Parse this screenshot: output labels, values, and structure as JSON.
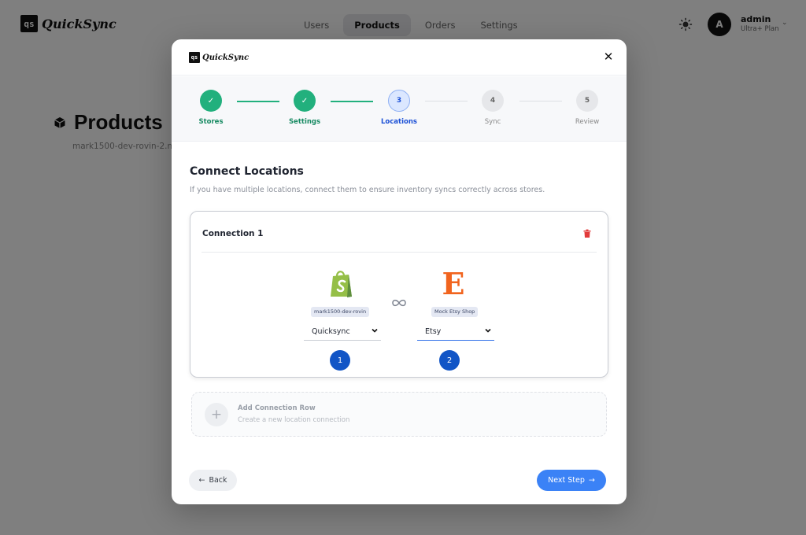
{
  "app": {
    "brand_mark": "qs",
    "brand_name": "QuickSync"
  },
  "nav": {
    "items": [
      {
        "label": "Users",
        "active": false
      },
      {
        "label": "Products",
        "active": true
      },
      {
        "label": "Orders",
        "active": false
      },
      {
        "label": "Settings",
        "active": false
      }
    ]
  },
  "user": {
    "avatar_initial": "A",
    "name": "admin",
    "plan": "Ultra+ Plan"
  },
  "page": {
    "title": "Products",
    "subtitle": "mark1500-dev-rovin-2.m"
  },
  "modal": {
    "steps": [
      {
        "number": "1",
        "label": "Stores",
        "status": "done"
      },
      {
        "number": "2",
        "label": "Settings",
        "status": "done"
      },
      {
        "number": "3",
        "label": "Locations",
        "status": "current"
      },
      {
        "number": "4",
        "label": "Sync",
        "status": "todo"
      },
      {
        "number": "5",
        "label": "Review",
        "status": "todo"
      }
    ],
    "section_title": "Connect Locations",
    "section_desc": "If you have multiple locations, connect them to ensure inventory syncs correctly across stores.",
    "connection": {
      "title": "Connection 1",
      "left_store": {
        "logo": "shopify-logo",
        "tag": "mark1500-dev-rovin",
        "location": "Quicksync",
        "badge": "1"
      },
      "right_store": {
        "logo": "etsy-logo",
        "logo_letter": "E",
        "tag": "Mock Etsy Shop",
        "location": "Etsy",
        "badge": "2"
      }
    },
    "add_row": {
      "title": "Add Connection Row",
      "subtitle": "Create a new location connection"
    },
    "back_label": "Back",
    "next_label": "Next Step"
  },
  "colors": {
    "step_done": "#22b07d",
    "step_current": "#1a4fd6",
    "primary_button": "#3b82f6",
    "badge": "#1155c6",
    "delete": "#e23b3b",
    "etsy": "#f1641e",
    "shopify": "#95bf47"
  }
}
